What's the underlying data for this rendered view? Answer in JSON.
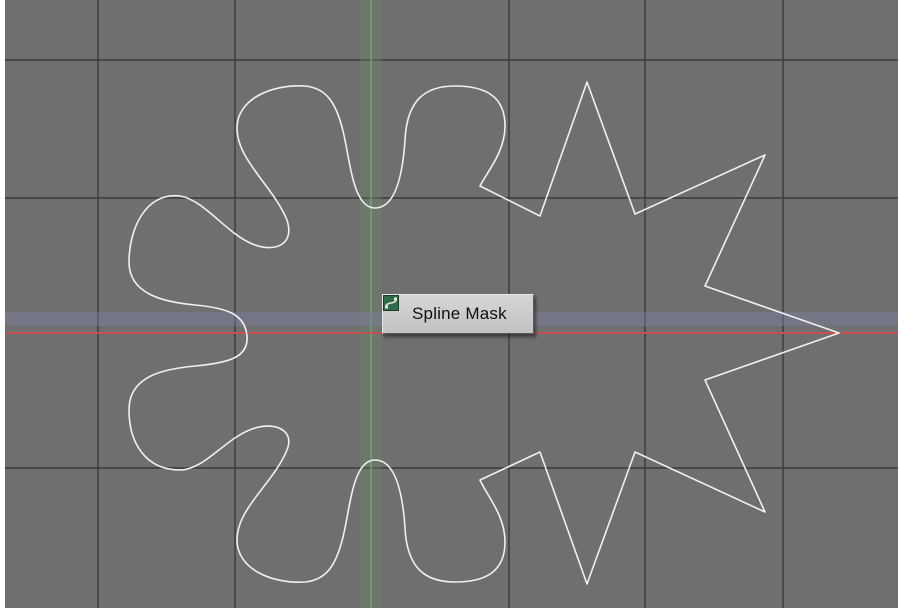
{
  "viewport": {
    "background": "#6f6f6f",
    "grid_color": "#3a3a3a",
    "x_axis_color": "#c45050",
    "y_axis_color": "#6a8a6a",
    "spline_color": "#f0f0f0"
  },
  "object_label": {
    "text": "Spline Mask",
    "icon": "spline-object-icon"
  }
}
